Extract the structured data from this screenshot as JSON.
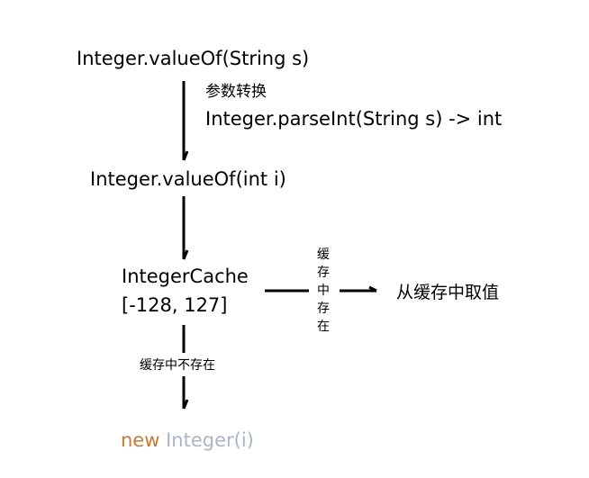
{
  "diagram": {
    "nodes": {
      "value_of_string": "Integer.valueOf(String s)",
      "conversion_label": "参数转换",
      "parse_int": "Integer.parseInt(String s)  -> int",
      "value_of_int": "Integer.valueOf(int i)",
      "integer_cache": "IntegerCache",
      "cache_range": "[-128, 127]",
      "get_from_cache": "从缓存中取值",
      "new_keyword": "new",
      "new_integer": "Integer(i)"
    },
    "edges": {
      "in_cache_label": [
        "缓",
        "存",
        "中",
        "存",
        "在"
      ],
      "not_in_cache_label": "缓存中不存在"
    },
    "colors": {
      "line": "#000000",
      "keyword": "#cc7832",
      "class_name": "#a9b7c6"
    }
  }
}
